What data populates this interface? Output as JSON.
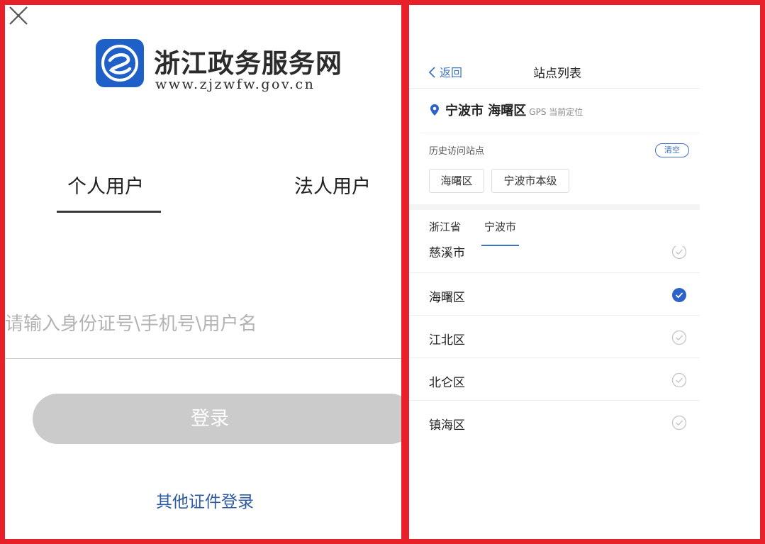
{
  "login": {
    "site_title": "浙江政务服务网",
    "site_url": "www.zjzwfw.gov.cn",
    "tabs": [
      {
        "label": "个人用户",
        "active": true
      },
      {
        "label": "法人用户",
        "active": false
      }
    ],
    "input": {
      "placeholder": "请输入身份证号\\手机号\\用户名",
      "value": ""
    },
    "login_button": "登录",
    "other_login": "其他证件登录"
  },
  "sites": {
    "back_label": "返回",
    "title": "站点列表",
    "gps": {
      "city": "宁波市 海曙区",
      "note": "GPS 当前定位"
    },
    "history": {
      "label": "历史访问站点",
      "clear_label": "清空",
      "items": [
        "海曙区",
        "宁波市本级"
      ]
    },
    "region_tabs": [
      {
        "label": "浙江省",
        "active": false
      },
      {
        "label": "宁波市",
        "active": true
      }
    ],
    "list": [
      {
        "label": "慈溪市",
        "selected": false
      },
      {
        "label": "海曙区",
        "selected": true
      },
      {
        "label": "江北区",
        "selected": false
      },
      {
        "label": "北仑区",
        "selected": false
      },
      {
        "label": "镇海区",
        "selected": false
      }
    ]
  },
  "colors": {
    "frame": "#e8202a",
    "accent": "#3d73c2",
    "link": "#2d5aa0",
    "button_disabled": "#cbcbcb",
    "check_selected": "#2b63c9",
    "check_unselected": "#c4c4c4"
  },
  "icons": {
    "close": "close-icon",
    "logo": "zjzwfw-logo-icon",
    "back": "chevron-left-icon",
    "location": "location-pin-icon",
    "check": "check-circle-icon"
  }
}
